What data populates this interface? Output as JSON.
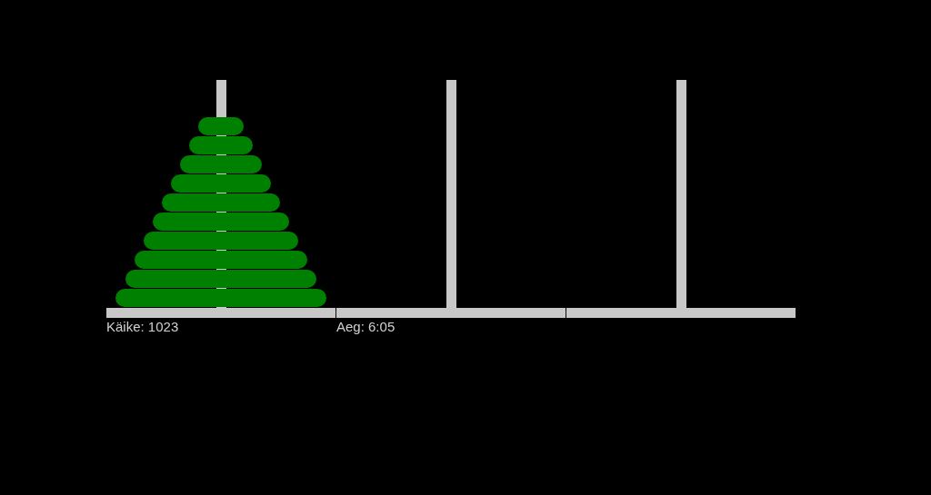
{
  "towers": [
    {
      "kind": "peg",
      "disks": [
        {
          "kind": "disk"
        },
        {
          "kind": "disk"
        },
        {
          "kind": "disk"
        },
        {
          "kind": "disk"
        },
        {
          "kind": "disk"
        },
        {
          "kind": "disk"
        },
        {
          "kind": "disk"
        },
        {
          "kind": "disk"
        },
        {
          "kind": "disk"
        },
        {
          "kind": "disk"
        }
      ]
    },
    {
      "kind": "peg"
    },
    {
      "kind": "peg"
    }
  ],
  "status": [
    "Käike: 1023",
    "Aeg: 6:05"
  ]
}
